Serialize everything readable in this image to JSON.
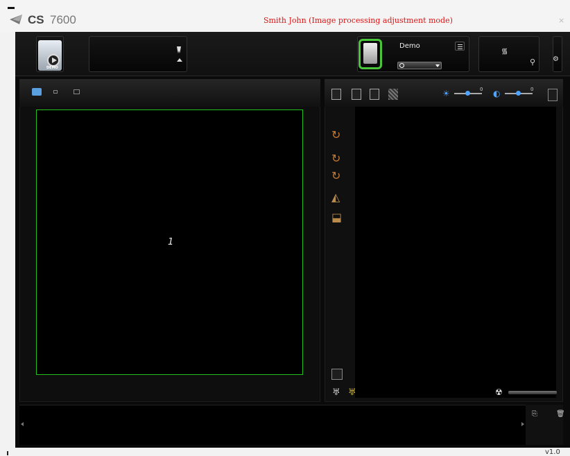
{
  "window": {
    "brand": "CS",
    "model": "7600",
    "title": "Smith John (Image processing adjustment mode)",
    "close_glyph": "×"
  },
  "toolbar": {
    "demo_badge": "DEMO",
    "device_name": "Demo",
    "wifi_glyph": "᯾",
    "usb_glyph": "⚲",
    "gear_glyph": "⚙"
  },
  "left_panel": {
    "viewport_label": "1"
  },
  "right_panel": {
    "brightness_value": "0",
    "contrast_value": "0",
    "brightness_glyph": "☀",
    "contrast_glyph": "◐",
    "arrow_tool_glyph": "↻",
    "mirror_glyph": "◭",
    "flip_glyph": "⬓",
    "radiation_glyph": "☢",
    "tooth_glyph": "♅"
  },
  "bottom": {
    "copy_glyph": "⎘",
    "delete_glyph": "🗑"
  },
  "footer": {
    "version": "v1.0"
  },
  "colors": {
    "accent_blue": "#4fa4ff",
    "viewport_border": "#24c01e",
    "title_red": "#e01010",
    "arrow_orange": "#c87a2f"
  }
}
